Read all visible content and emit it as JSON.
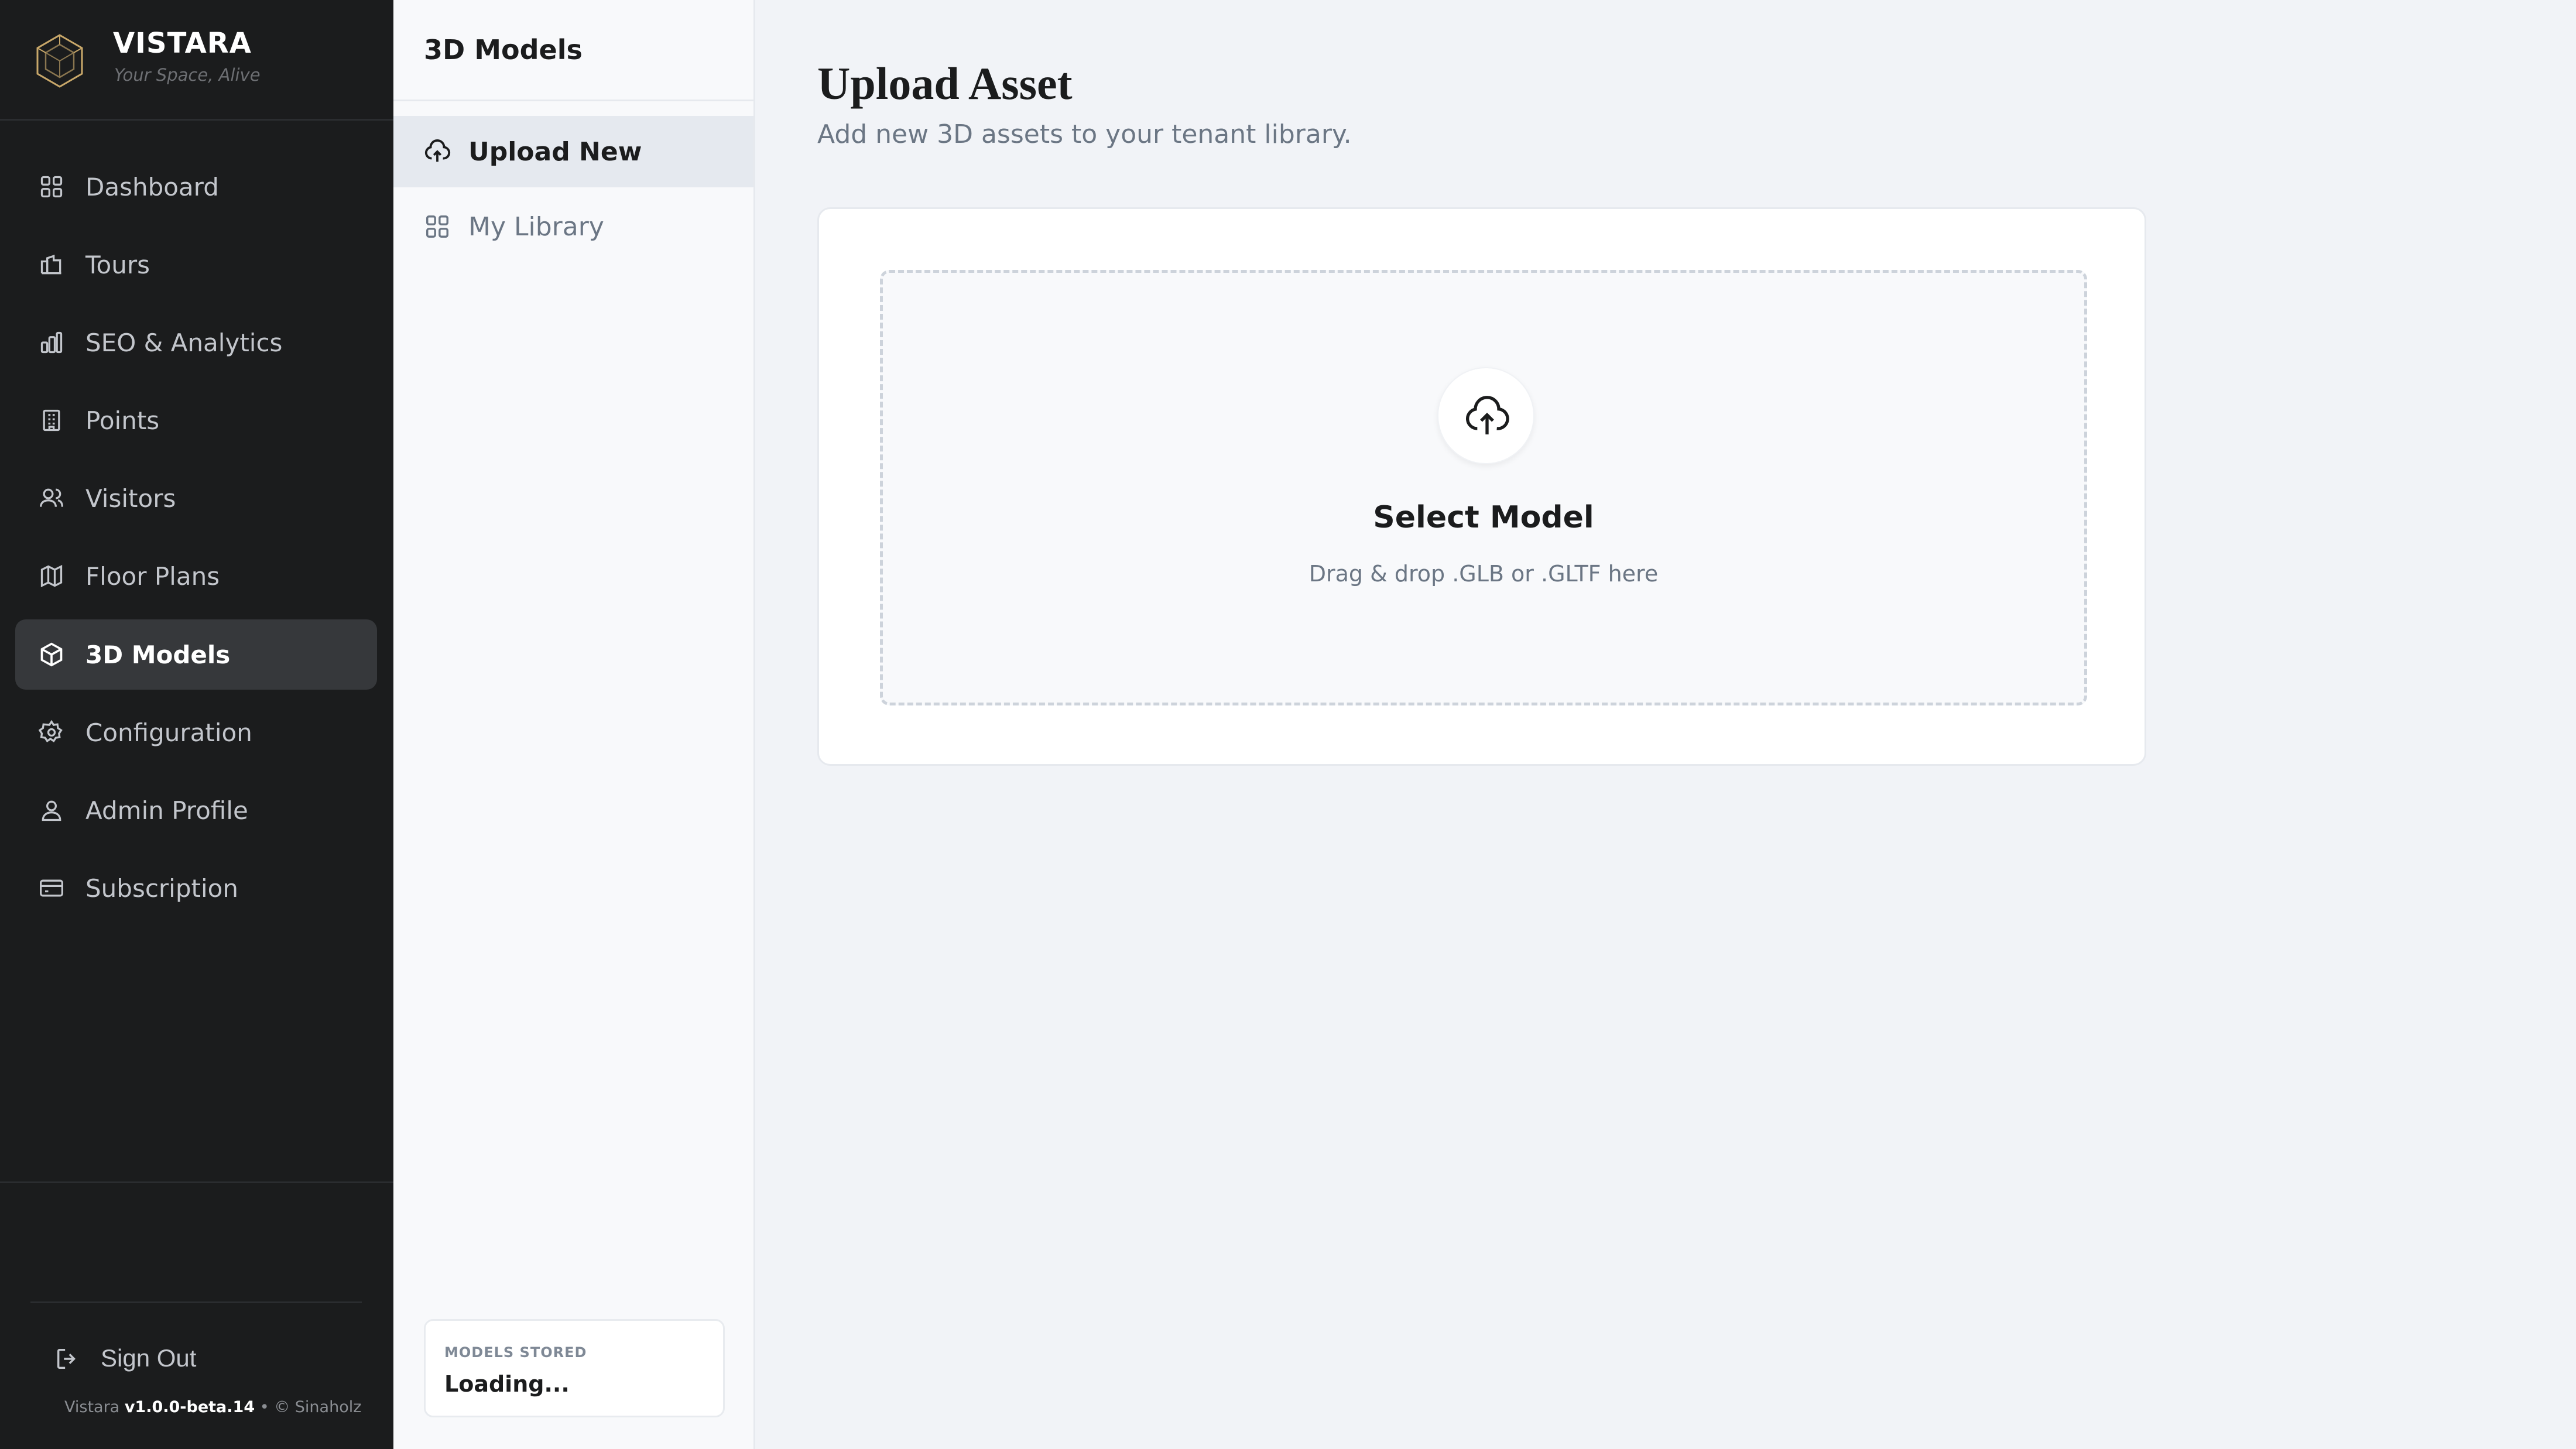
{
  "brand": {
    "name": "VISTARA",
    "tagline": "Your Space, Alive"
  },
  "sidebar": {
    "items": [
      {
        "label": "Dashboard",
        "icon": "grid-icon"
      },
      {
        "label": "Tours",
        "icon": "tour-icon"
      },
      {
        "label": "SEO & Analytics",
        "icon": "bar-chart-icon"
      },
      {
        "label": "Points",
        "icon": "building-icon"
      },
      {
        "label": "Visitors",
        "icon": "users-icon"
      },
      {
        "label": "Floor Plans",
        "icon": "map-icon"
      },
      {
        "label": "3D Models",
        "icon": "cube-icon",
        "active": true
      },
      {
        "label": "Configuration",
        "icon": "gear-icon"
      },
      {
        "label": "Admin Profile",
        "icon": "user-icon"
      },
      {
        "label": "Subscription",
        "icon": "card-icon"
      }
    ],
    "sign_out": "Sign Out",
    "version_prefix": "Vistara",
    "version": "v1.0.0-beta.14",
    "version_suffix": "• © Sinaholz"
  },
  "subpanel": {
    "title": "3D Models",
    "items": [
      {
        "label": "Upload New",
        "icon": "upload-cloud-icon",
        "active": true
      },
      {
        "label": "My Library",
        "icon": "grid-icon"
      }
    ],
    "stored_label": "MODELS STORED",
    "stored_value": "Loading..."
  },
  "main": {
    "title": "Upload Asset",
    "subtitle": "Add new 3D assets to your tenant library.",
    "dropzone": {
      "title": "Select Model",
      "hint": "Drag & drop .GLB or .GLTF here"
    }
  },
  "colors": {
    "sidebar_bg": "#1b1c1d",
    "active_nav_bg": "#36383b",
    "page_bg": "#f1f3f7",
    "accent_text": "#1b1c1d",
    "muted_text": "#6b7684"
  }
}
